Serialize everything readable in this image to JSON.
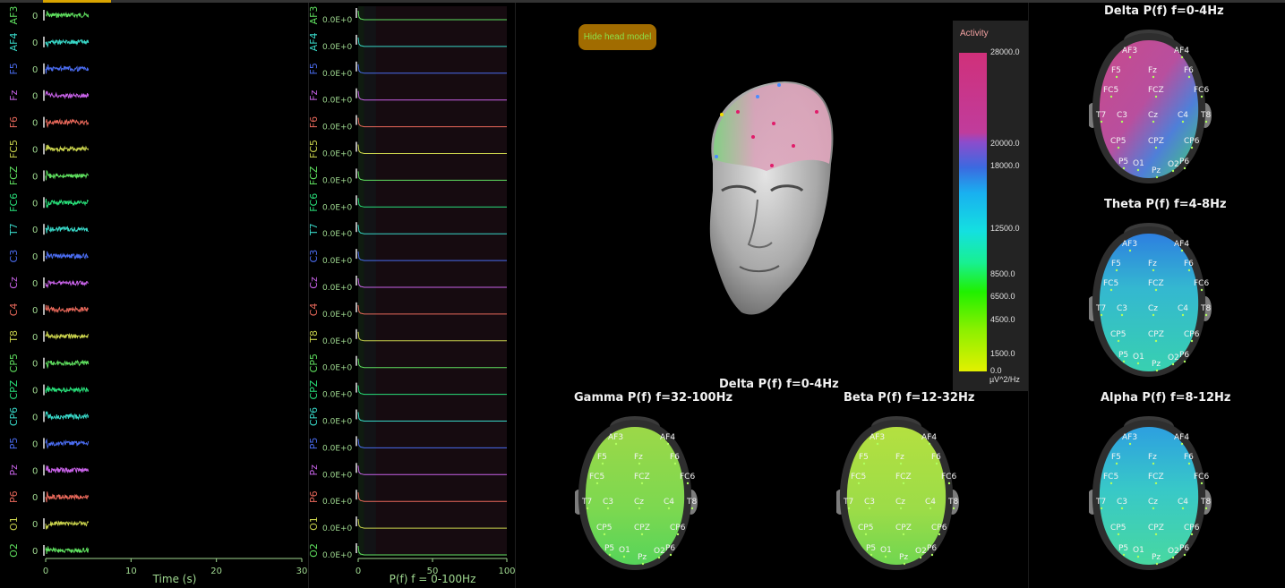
{
  "channels": [
    "AF3",
    "AF4",
    "F5",
    "Fz",
    "F6",
    "FC5",
    "FCZ",
    "FC6",
    "T7",
    "C3",
    "Cz",
    "C4",
    "T8",
    "CP5",
    "CPZ",
    "CP6",
    "P5",
    "Pz",
    "P6",
    "O1",
    "O2"
  ],
  "channel_colors": [
    "#5fe05f",
    "#38d8c8",
    "#4a6cf0",
    "#c862e8",
    "#e8685a",
    "#c9d24c",
    "#5fe05f",
    "#28e07a",
    "#38d8c8",
    "#4a6cf0",
    "#c862e8",
    "#e8685a",
    "#c9d24c",
    "#5fe05f",
    "#28e07a",
    "#38d8c8",
    "#4a6cf0",
    "#c862e8",
    "#e8685a",
    "#c9d24c",
    "#5fe05f"
  ],
  "time_plot": {
    "channel_value": "0",
    "xlabel": "Time (s)",
    "xticks": [
      "0",
      "10",
      "20",
      "30"
    ],
    "xlim": [
      0,
      30
    ],
    "signal_end_s": 5
  },
  "psd_plot": {
    "channel_value": "0.0E+0",
    "xlabel": "P(f) f = 0-100Hz",
    "xticks": [
      "0",
      "50",
      "100"
    ],
    "xlim": [
      0,
      100
    ]
  },
  "head_model": {
    "hide_button_label": "Hide head model",
    "subtitle": "Delta P(f) f=0-4Hz"
  },
  "legend": {
    "title": "Activity",
    "unit": "µV^2/Hz",
    "max": 28000,
    "ticks": [
      "28000.0",
      "20000.0",
      "18000.0",
      "12500.0",
      "8500.0",
      "6500.0",
      "4500.0",
      "1500.0",
      "0.0"
    ],
    "tick_values": [
      28000,
      20000,
      18000,
      12500,
      8500,
      6500,
      4500,
      1500,
      0
    ]
  },
  "electrode_labels": [
    "AF3",
    "AF4",
    "F5",
    "Fz",
    "F6",
    "FC5",
    "FCZ",
    "FC6",
    "T7",
    "C3",
    "Cz",
    "C4",
    "T8",
    "CP5",
    "CPZ",
    "CP6",
    "P5",
    "O1",
    "Pz",
    "O2",
    "P6"
  ],
  "topo_maps": [
    {
      "id": "delta",
      "title": "Delta P(f) f=0-4Hz",
      "scheme": "delta"
    },
    {
      "id": "theta",
      "title": "Theta P(f) f=4-8Hz",
      "scheme": "theta"
    },
    {
      "id": "alpha",
      "title": "Alpha P(f) f=8-12Hz",
      "scheme": "alpha"
    },
    {
      "id": "gamma",
      "title": "Gamma P(f) f=32-100Hz",
      "scheme": "gamma"
    },
    {
      "id": "beta",
      "title": "Beta P(f) f=12-32Hz",
      "scheme": "beta"
    }
  ],
  "colors": {
    "axis": "#9fd890",
    "psd_background": "#160b10",
    "button_bg": "#a16c00",
    "button_text": "#8de04a"
  }
}
